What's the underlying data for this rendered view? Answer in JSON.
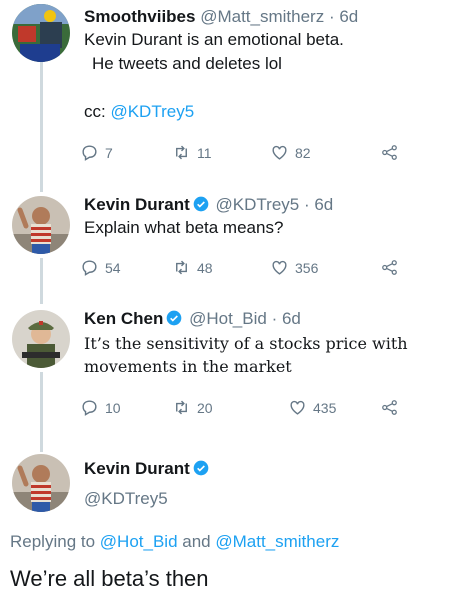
{
  "tweets": [
    {
      "name": "Smoothviibes",
      "handle": "@Matt_smitherz",
      "time": "· 6d",
      "line1": "Kevin Durant is an emotional beta.",
      "line2": "He tweets and deletes lol",
      "cc_prefix": "cc: ",
      "cc_mention": "@KDTrey5",
      "replies": "7",
      "retweets": "11",
      "likes": "82"
    },
    {
      "name": "Kevin Durant",
      "handle": "@KDTrey5",
      "time": "· 6d",
      "line1": "Explain what beta means?",
      "replies": "54",
      "retweets": "48",
      "likes": "356"
    },
    {
      "name": "Ken Chen",
      "handle": "@Hot_Bid",
      "time": "· 6d",
      "line1": "It’s the sensitivity of a stocks price with",
      "line2": "movements in the market",
      "replies": "10",
      "retweets": "20",
      "likes": "435"
    }
  ],
  "main_tweet": {
    "name": "Kevin Durant",
    "handle": "@KDTrey5",
    "replying_prefix": "Replying to ",
    "replying_user1": "@Hot_Bid",
    "replying_and": " and ",
    "replying_user2": "@Matt_smitherz",
    "text": "We’re all beta’s then"
  },
  "colors": {
    "accent": "#1da1f2",
    "muted": "#657786",
    "thread_line": "#cfd9de"
  },
  "icons": [
    "reply-icon",
    "retweet-icon",
    "like-icon",
    "share-icon",
    "verified-badge-icon"
  ]
}
